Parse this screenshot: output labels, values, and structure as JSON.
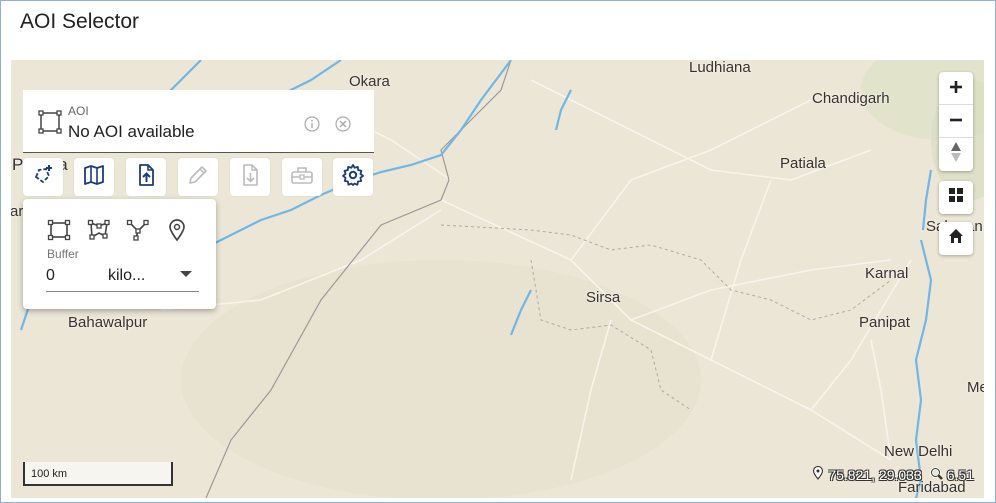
{
  "header": {
    "title": "AOI Selector"
  },
  "aoi": {
    "label": "AOI",
    "value": "No AOI available"
  },
  "buffer": {
    "label": "Buffer",
    "value": "0",
    "unit": "kilo..."
  },
  "map": {
    "cities": [
      {
        "name": "Okara",
        "id": "okara"
      },
      {
        "name": "Ludhiana",
        "id": "ludhiana"
      },
      {
        "name": "Chandigarh",
        "id": "chandigarh"
      },
      {
        "name": "Patiala",
        "id": "patiala"
      },
      {
        "name": "Saharan",
        "id": "saharan"
      },
      {
        "name": "Karnal",
        "id": "karnal"
      },
      {
        "name": "Sirsa",
        "id": "sirsa"
      },
      {
        "name": "Panipat",
        "id": "panipat"
      },
      {
        "name": "Bahawalpur",
        "id": "bahawalpur"
      },
      {
        "name": "New Delhi",
        "id": "new-delhi"
      },
      {
        "name": "Faridabad",
        "id": "faridabad"
      },
      {
        "name": "Pakista",
        "id": "pakistan"
      },
      {
        "name": "ar",
        "id": "ar-partial"
      },
      {
        "name": "Me",
        "id": "me-partial"
      }
    ],
    "scale_label": "100 km",
    "coords": "75.821, 29.033",
    "zoom_level": "6.51",
    "colors": {
      "land": "#ece6d6",
      "water": "#6fb7e6",
      "border": "#8f8f8f",
      "accent": "#1a3d7c"
    }
  },
  "icons": {
    "aoi": "bounding-box-icon",
    "info": "info-icon",
    "close": "close-circle-icon",
    "tools": [
      "draw-polygon-icon",
      "map-icon",
      "upload-file-icon",
      "pencil-icon",
      "download-file-icon",
      "toolbox-icon",
      "gear-icon"
    ],
    "draw": [
      "rectangle-icon",
      "polygon-icon",
      "line-icon",
      "point-icon"
    ],
    "map_controls": [
      "zoom-in-icon",
      "zoom-out-icon",
      "compass-icon",
      "basemap-grid-icon",
      "home-icon"
    ]
  }
}
